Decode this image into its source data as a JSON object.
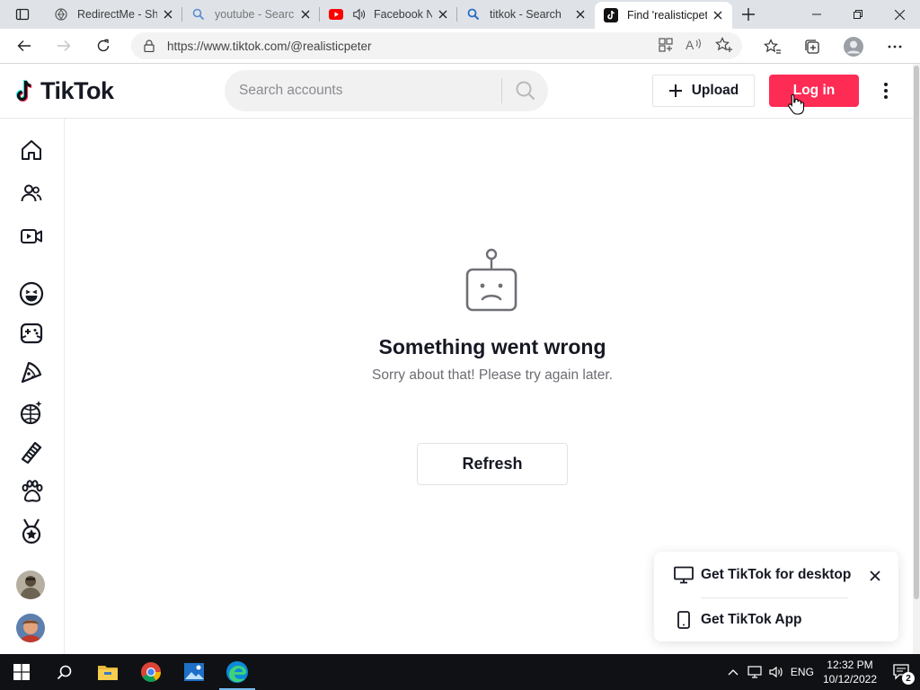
{
  "browser": {
    "tabs": [
      {
        "title": "RedirectMe - Sh",
        "icon": "redirect-globe-icon"
      },
      {
        "title": "youtube - Searc",
        "icon": "search-icon"
      },
      {
        "title": "Facebook N",
        "icon": "youtube-icon"
      },
      {
        "title": "titkok - Search",
        "icon": "search-icon"
      },
      {
        "title": "Find 'realisticpet",
        "icon": "tiktok-icon",
        "active": true
      }
    ],
    "url": "https://www.tiktok.com/@realisticpeter"
  },
  "header": {
    "logo": "TikTok",
    "search_placeholder": "Search accounts",
    "upload_label": "Upload",
    "login_label": "Log in"
  },
  "error": {
    "title": "Something went wrong",
    "subtitle": "Sorry about that! Please try again later.",
    "refresh_label": "Refresh"
  },
  "popup": {
    "desktop_label": "Get TikTok for desktop",
    "app_label": "Get TikTok App"
  },
  "taskbar": {
    "language": "ENG",
    "time": "12:32 PM",
    "date": "10/12/2022",
    "notifications": "2"
  },
  "colors": {
    "brand": "#fe2c55",
    "taskbar": "#101114"
  }
}
